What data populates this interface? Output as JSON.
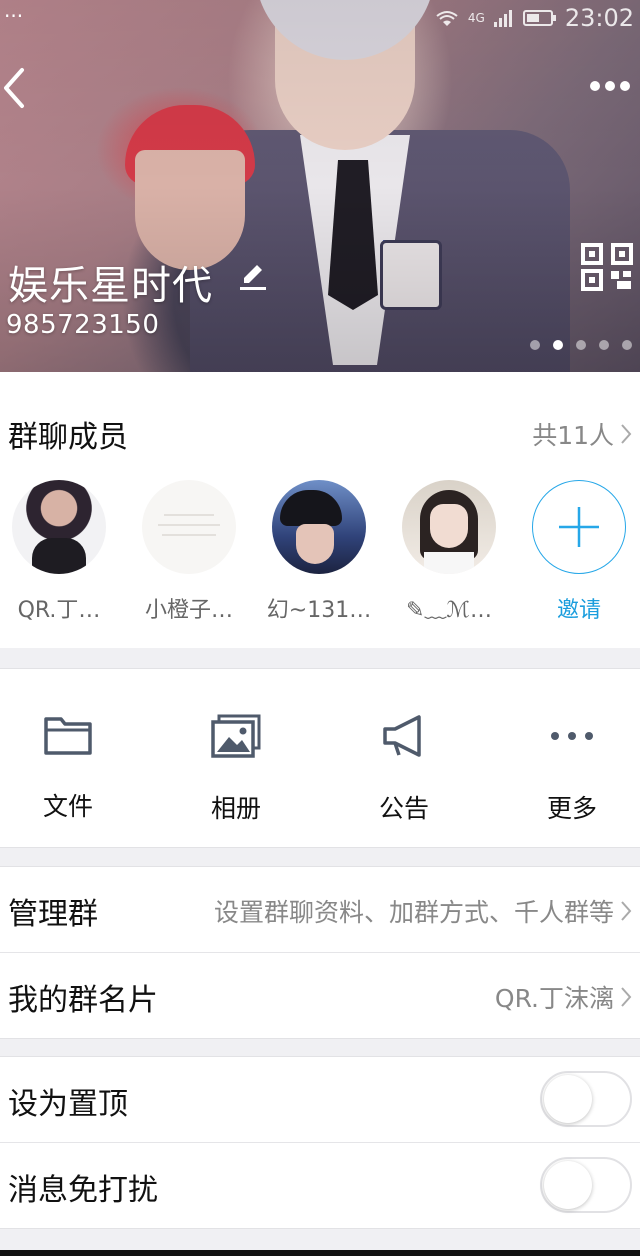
{
  "status_bar": {
    "left_dots": "···",
    "network": "4G",
    "time": "23:02"
  },
  "header": {
    "group_name": "娱乐星时代",
    "group_id": "985723150",
    "page_count": 5,
    "active_page": 2
  },
  "members": {
    "title": "群聊成员",
    "count_label": "共11人",
    "list": [
      {
        "name": "QR.丁…"
      },
      {
        "name": "小橙子…"
      },
      {
        "name": "幻~131…"
      },
      {
        "name": "✎﹏ℳ…"
      }
    ],
    "invite_label": "邀请"
  },
  "actions": [
    {
      "label": "文件",
      "icon": "folder-icon"
    },
    {
      "label": "相册",
      "icon": "album-icon"
    },
    {
      "label": "公告",
      "icon": "megaphone-icon"
    },
    {
      "label": "更多",
      "icon": "more-icon"
    }
  ],
  "manage": {
    "label": "管理群",
    "value": "设置群聊资料、加群方式、千人群等"
  },
  "card": {
    "label": "我的群名片",
    "value": "QR.丁沫漓"
  },
  "settings": {
    "pin": {
      "label": "设为置顶",
      "on": false
    },
    "mute": {
      "label": "消息免打扰",
      "on": false
    }
  },
  "colors": {
    "accent": "#26a7e8",
    "icon_gray": "#4f5a6b"
  }
}
